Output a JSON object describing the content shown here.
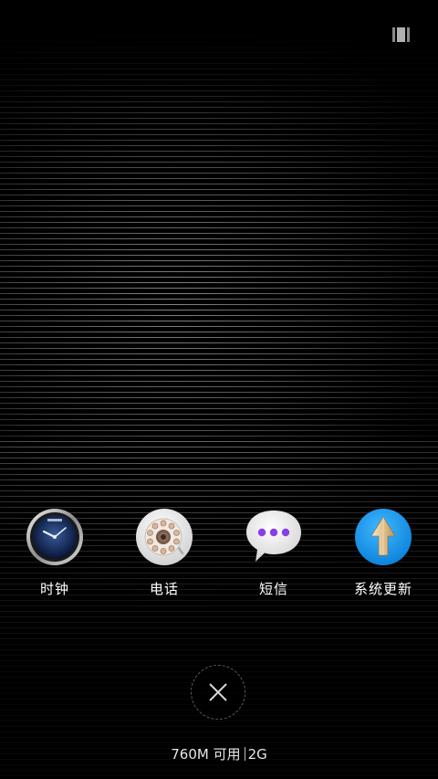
{
  "apps": [
    {
      "name": "时钟",
      "icon": "clock-icon"
    },
    {
      "name": "电话",
      "icon": "rotary-phone-icon"
    },
    {
      "name": "短信",
      "icon": "message-bubble-icon"
    },
    {
      "name": "系统更新",
      "icon": "system-update-arrow-icon"
    }
  ],
  "memory": {
    "available": "760M 可用",
    "total": "2G"
  },
  "toolbar": {
    "recent_toggle_icon": "recent-view-toggle-icon",
    "close_icon": "close-icon"
  },
  "colors": {
    "background": "#000000",
    "label": "#ffffff",
    "update_blue": "#1a9cf0",
    "message_purple": "#8a3ee6"
  }
}
